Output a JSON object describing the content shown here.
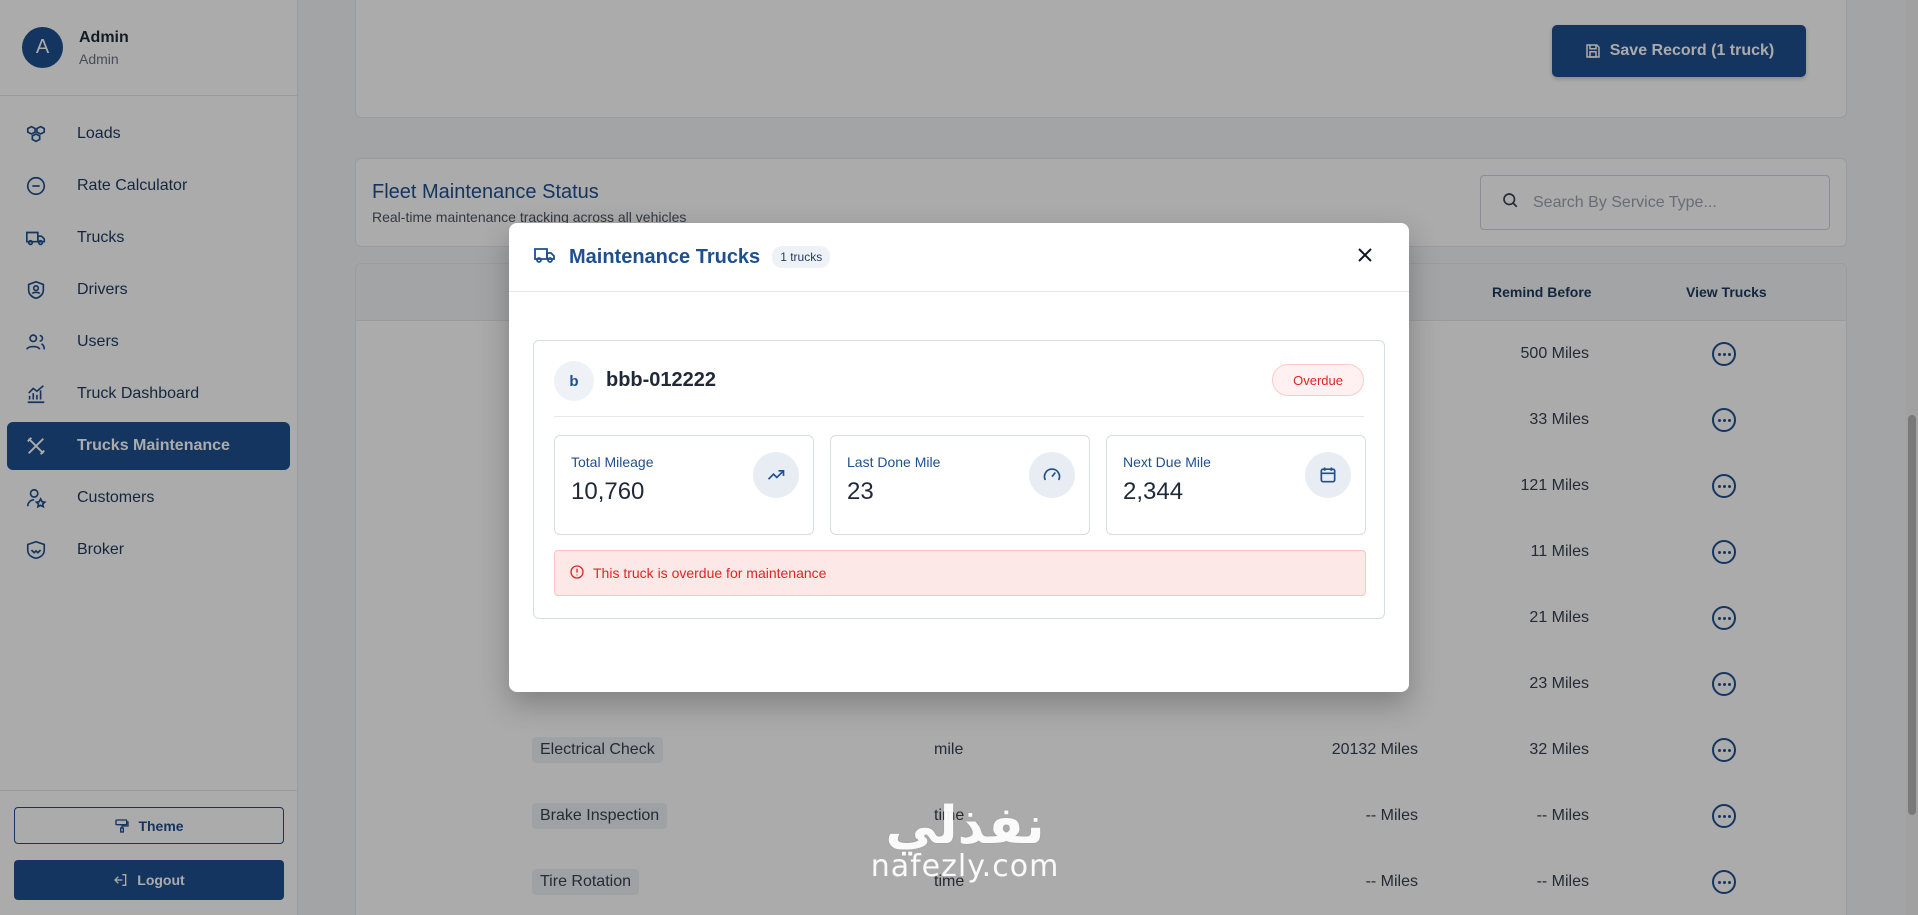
{
  "user": {
    "initial": "A",
    "name": "Admin",
    "role": "Admin"
  },
  "nav": [
    {
      "label": "Loads",
      "icon": "boxes-icon"
    },
    {
      "label": "Rate Calculator",
      "icon": "circle-minus-icon"
    },
    {
      "label": "Trucks",
      "icon": "truck-icon"
    },
    {
      "label": "Drivers",
      "icon": "shield-user-icon"
    },
    {
      "label": "Users",
      "icon": "users-icon"
    },
    {
      "label": "Truck Dashboard",
      "icon": "chart-icon"
    },
    {
      "label": "Trucks Maintenance",
      "icon": "tools-icon",
      "active": true
    },
    {
      "label": "Customers",
      "icon": "user-star-icon"
    },
    {
      "label": "Broker",
      "icon": "handshake-icon"
    }
  ],
  "sidebar_bottom": {
    "theme": "Theme",
    "logout": "Logout"
  },
  "top_card": {
    "save_label": "Save Record (1 truck)"
  },
  "status": {
    "title": "Fleet Maintenance Status",
    "subtitle": "Real-time maintenance tracking across all vehicles",
    "search_placeholder": "Search By Service Type..."
  },
  "table": {
    "headers": {
      "remind_before": "Remind Before",
      "view_trucks": "View Trucks"
    },
    "rows": [
      {
        "service": "",
        "type": "",
        "interval": "",
        "remind": "500 Miles"
      },
      {
        "service": "",
        "type": "",
        "interval": "",
        "remind": "33 Miles"
      },
      {
        "service": "",
        "type": "",
        "interval": "",
        "remind": "121 Miles"
      },
      {
        "service": "",
        "type": "",
        "interval": "",
        "remind": "11 Miles"
      },
      {
        "service": "",
        "type": "",
        "interval": "",
        "remind": "21 Miles"
      },
      {
        "service": "",
        "type": "",
        "interval": "",
        "remind": "23 Miles"
      },
      {
        "service": "Electrical Check",
        "type": "mile",
        "interval": "20132 Miles",
        "remind": "32 Miles"
      },
      {
        "service": "Brake Inspection",
        "type": "time",
        "interval": "-- Miles",
        "remind": "-- Miles"
      },
      {
        "service": "Tire Rotation",
        "type": "time",
        "interval": "-- Miles",
        "remind": "-- Miles"
      }
    ]
  },
  "modal": {
    "title": "Maintenance Trucks",
    "count": "1 trucks",
    "truck": {
      "initial": "b",
      "id": "bbb-012222",
      "status": "Overdue",
      "stats": [
        {
          "label": "Total Mileage",
          "value": "10,760",
          "icon": "trending-up-icon"
        },
        {
          "label": "Last Done Mile",
          "value": "23",
          "icon": "gauge-icon"
        },
        {
          "label": "Next Due Mile",
          "value": "2,344",
          "icon": "calendar-icon"
        }
      ],
      "alert": "This truck is overdue for maintenance"
    }
  },
  "watermark": {
    "arabic": "نفذلي",
    "latin": "nafezly.com"
  },
  "colors": {
    "primary": "#1e4f8f",
    "danger": "#dc2626",
    "danger_bg": "#fde8e8"
  }
}
